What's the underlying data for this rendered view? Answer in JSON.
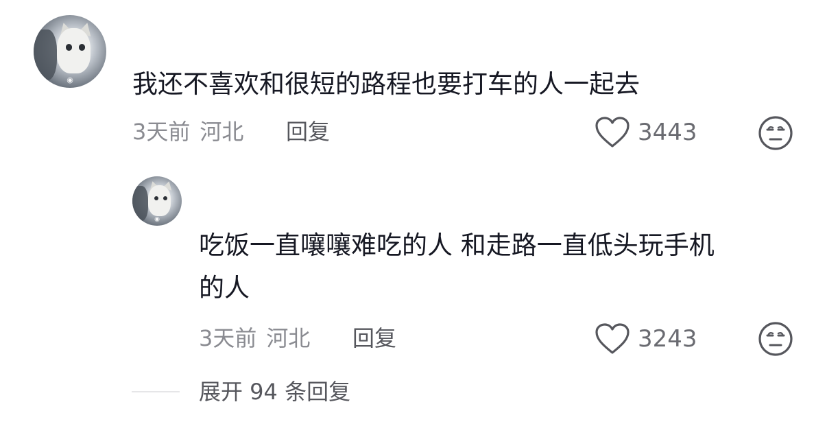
{
  "comments": [
    {
      "text": "我还不喜欢和很短的路程也要打车的人一起去",
      "time": "3天前",
      "location": "河北",
      "reply_label": "回复",
      "likes": "3443",
      "avatar_icon": "cat-avatar",
      "like_icon": "heart-icon",
      "dislike_icon": "unamused-face-icon"
    }
  ],
  "replies": [
    {
      "text": "吃饭一直嚷嚷难吃的人 和走路一直低头玩手机\n的人",
      "time": "3天前",
      "location": "河北",
      "reply_label": "回复",
      "likes": "3243",
      "avatar_icon": "cat-avatar",
      "like_icon": "heart-icon",
      "dislike_icon": "unamused-face-icon"
    }
  ],
  "expand": {
    "label": "展开 94 条回复"
  },
  "colors": {
    "text": "#161823",
    "meta": "#8a8b91",
    "icon": "#56575d"
  }
}
